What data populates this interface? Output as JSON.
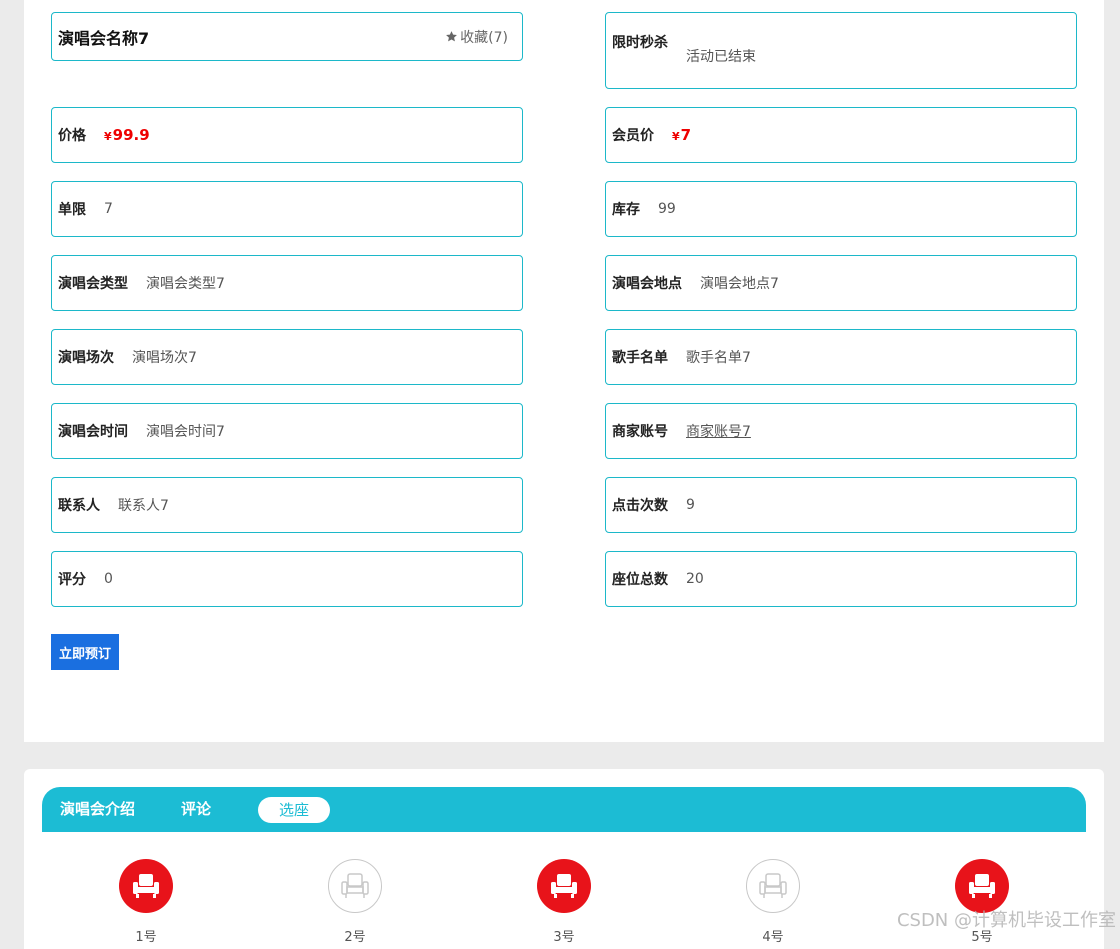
{
  "title": "演唱会名称7",
  "favorite": {
    "label": "收藏(7)",
    "icon": "star-icon"
  },
  "seckill": {
    "label": "限时秒杀",
    "status": "活动已结束"
  },
  "price": {
    "label": "价格",
    "currency": "¥",
    "value": "99.9"
  },
  "member_price": {
    "label": "会员价",
    "currency": "¥",
    "value": "7"
  },
  "limit": {
    "label": "单限",
    "value": "7"
  },
  "stock": {
    "label": "库存",
    "value": "99"
  },
  "type": {
    "label": "演唱会类型",
    "value": "演唱会类型7"
  },
  "venue": {
    "label": "演唱会地点",
    "value": "演唱会地点7"
  },
  "session": {
    "label": "演唱场次",
    "value": "演唱场次7"
  },
  "singers": {
    "label": "歌手名单",
    "value": "歌手名单7"
  },
  "time": {
    "label": "演唱会时间",
    "value": "演唱会时间7"
  },
  "merchant": {
    "label": "商家账号",
    "value": "商家账号7"
  },
  "contact": {
    "label": "联系人",
    "value": "联系人7"
  },
  "clicks": {
    "label": "点击次数",
    "value": "9"
  },
  "rating": {
    "label": "评分",
    "value": "0"
  },
  "seats_total": {
    "label": "座位总数",
    "value": "20"
  },
  "book_button": "立即预订",
  "tabs": [
    {
      "label": "演唱会介绍"
    },
    {
      "label": "评论"
    },
    {
      "label": "选座"
    }
  ],
  "seats": [
    {
      "label": "1号",
      "status": "taken"
    },
    {
      "label": "2号",
      "status": "free"
    },
    {
      "label": "3号",
      "status": "taken"
    },
    {
      "label": "4号",
      "status": "free"
    },
    {
      "label": "5号",
      "status": "taken"
    }
  ],
  "watermark": "CSDN @计算机毕设工作室",
  "colors": {
    "accent": "#1cbcd4",
    "price": "#e00000",
    "button": "#1a6fe0",
    "seat_taken": "#e8131a"
  }
}
